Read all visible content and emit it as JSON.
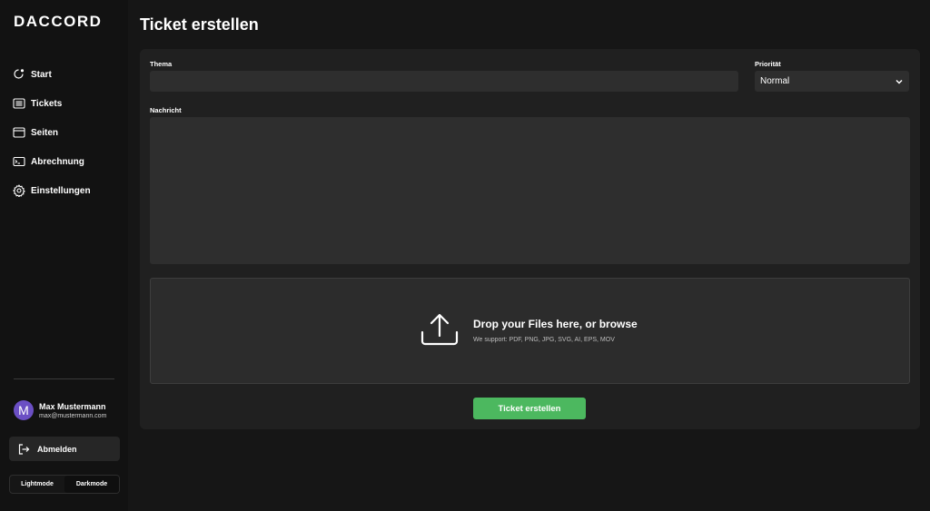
{
  "brand": {
    "logo_text": "DACCORD"
  },
  "sidebar": {
    "items": [
      {
        "label": "Start",
        "icon": "home-icon"
      },
      {
        "label": "Tickets",
        "icon": "list-icon"
      },
      {
        "label": "Seiten",
        "icon": "browser-icon"
      },
      {
        "label": "Abrechnung",
        "icon": "billing-icon"
      },
      {
        "label": "Einstellungen",
        "icon": "gear-icon"
      }
    ],
    "user": {
      "initial": "M",
      "name": "Max Mustermann",
      "email": "max@mustermann.com"
    },
    "logout_label": "Abmelden",
    "mode_toggle": {
      "light_label": "Lightmode",
      "dark_label": "Darkmode",
      "active": "Darkmode"
    }
  },
  "page": {
    "title": "Ticket erstellen"
  },
  "form": {
    "topic_label": "Thema",
    "topic_value": "",
    "priority_label": "Priorität",
    "priority_value": "Normal",
    "message_label": "Nachricht",
    "message_value": "",
    "dropzone": {
      "title": "Drop your Files here, or browse",
      "subtitle": "We support: PDF, PNG, JPG, SVG, AI, EPS, MOV"
    },
    "submit_label": "Ticket erstellen"
  },
  "colors": {
    "background": "#161616",
    "sidebar": "#121212",
    "panel": "#202020",
    "input": "#2e2e2e",
    "accent_green": "#4cb85f",
    "avatar": "#6b4fc4"
  }
}
